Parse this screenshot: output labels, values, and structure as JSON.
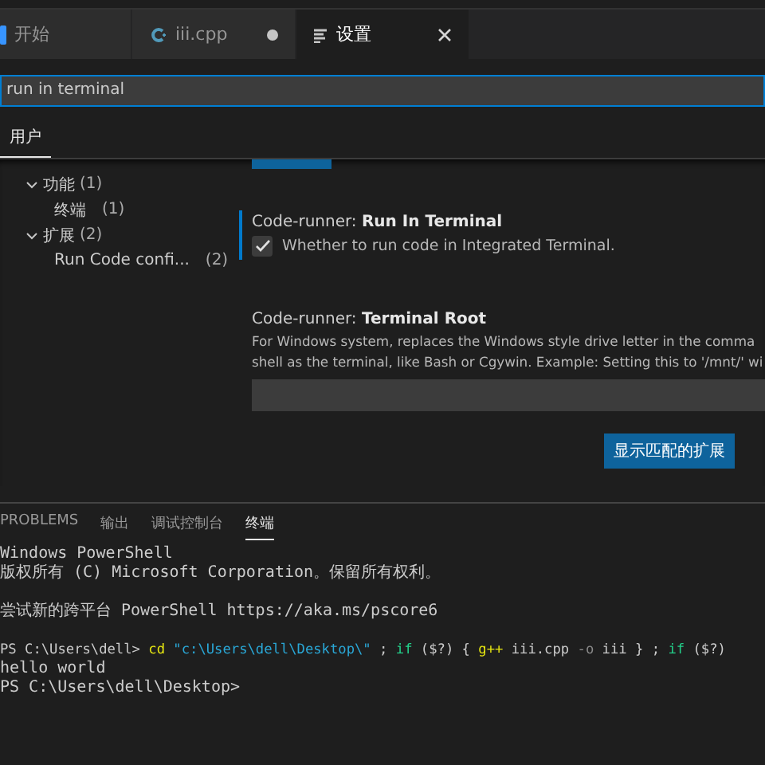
{
  "tabs": [
    {
      "label": "开始",
      "kind": "welcome",
      "selected": false,
      "modified": false
    },
    {
      "label": "iii.cpp",
      "kind": "cpp",
      "selected": false,
      "modified": true
    },
    {
      "label": "设置",
      "kind": "settings",
      "selected": true,
      "modified": false
    }
  ],
  "search": {
    "value": "run in terminal"
  },
  "scope_tabs": [
    {
      "label": "用户",
      "selected": true
    }
  ],
  "tree": [
    {
      "label": "功能",
      "count": "(1)",
      "expanded": true,
      "children": [
        {
          "label": "终端",
          "count": "(1)"
        }
      ]
    },
    {
      "label": "扩展",
      "count": "(2)",
      "expanded": true,
      "children": [
        {
          "label": "Run Code confi...",
          "count": "(2)"
        }
      ]
    }
  ],
  "settings": [
    {
      "kind": "checkbox",
      "category": "Code-runner: ",
      "name": "Run In Terminal",
      "focused": true,
      "checked": true,
      "description": [
        "Whether to run code in Integrated Terminal."
      ]
    },
    {
      "kind": "text",
      "category": "Code-runner: ",
      "name": "Terminal Root",
      "focused": false,
      "description": [
        "For Windows system, replaces the Windows style drive letter in the comma",
        "shell as the terminal, like Bash or Cgywin. Example: Setting this to '/mnt/' wi"
      ]
    }
  ],
  "extensions_button": "显示匹配的扩展",
  "panel_tabs": [
    {
      "label": "PROBLEMS",
      "selected": false
    },
    {
      "label": "输出",
      "selected": false
    },
    {
      "label": "调试控制台",
      "selected": false
    },
    {
      "label": "终端",
      "selected": true
    }
  ],
  "terminal": [
    [
      [
        {
          "text": "Windows PowerShell",
          "kind": "plain"
        }
      ],
      [
        {
          "text": "版权所有 (C) Microsoft Corporation。保留所有权利。",
          "kind": "plain"
        }
      ]
    ],
    [
      [
        {
          "text": "尝试新的跨平台 PowerShell https://aka.ms/pscore6",
          "kind": "plain"
        }
      ]
    ],
    [
      [
        {
          "text": "PS C:\\Users\\dell> ",
          "kind": "plain"
        },
        {
          "text": "cd",
          "kind": "command"
        },
        {
          "text": " \"c:\\Users\\dell\\Desktop\\\"",
          "kind": "string"
        },
        {
          "text": " ; ",
          "kind": "plain"
        },
        {
          "text": "if",
          "kind": "keyword"
        },
        {
          "text": " ($?) { ",
          "kind": "plain"
        },
        {
          "text": "g++",
          "kind": "command"
        },
        {
          "text": " iii.cpp ",
          "kind": "plain"
        },
        {
          "text": "-o",
          "kind": "param"
        },
        {
          "text": " iii } ; ",
          "kind": "plain"
        },
        {
          "text": "if",
          "kind": "keyword"
        },
        {
          "text": " ($?)",
          "kind": "plain"
        }
      ],
      [
        {
          "text": "hello world",
          "kind": "plain"
        }
      ],
      [
        {
          "text": "PS C:\\Users\\dell\\Desktop>",
          "kind": "plain"
        }
      ]
    ]
  ]
}
